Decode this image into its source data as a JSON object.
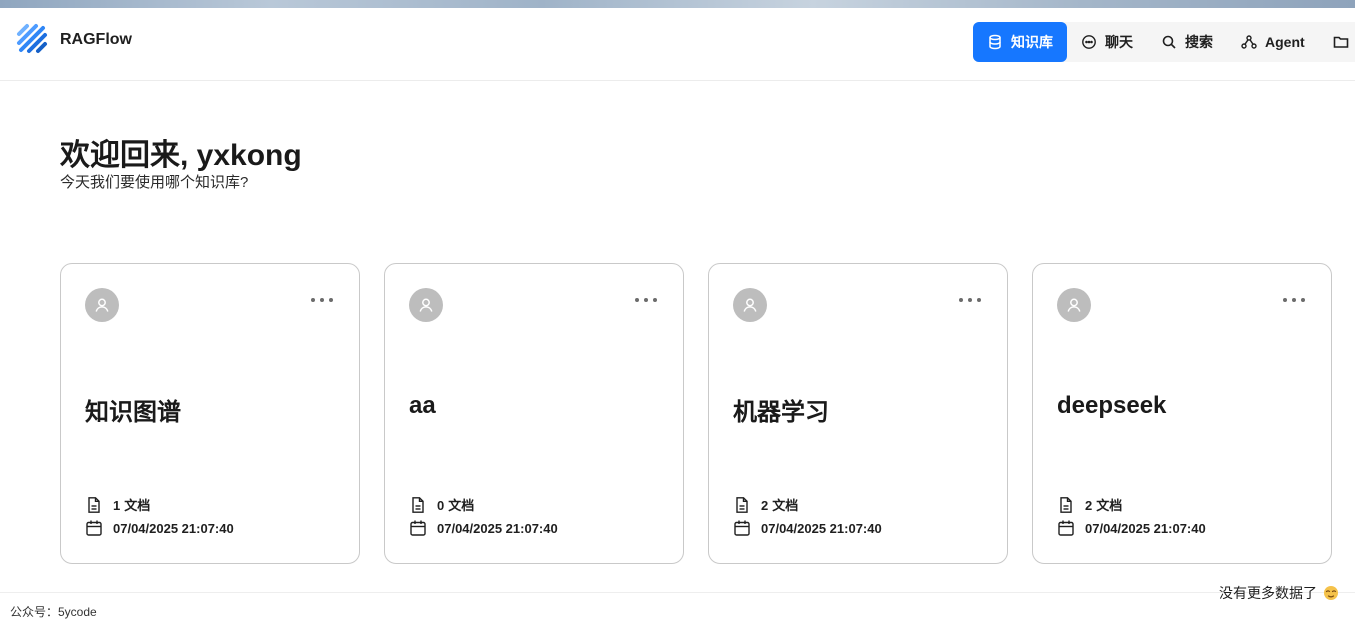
{
  "app": {
    "name": "RAGFlow"
  },
  "nav": {
    "items": [
      {
        "label": "知识库",
        "icon": "database-icon",
        "active": true
      },
      {
        "label": "聊天",
        "icon": "chat-icon",
        "active": false
      },
      {
        "label": "搜索",
        "icon": "search-icon",
        "active": false
      },
      {
        "label": "Agent",
        "icon": "agent-icon",
        "active": false
      },
      {
        "label": "",
        "icon": "folder-icon",
        "active": false
      }
    ]
  },
  "colors": {
    "accent": "#1677ff",
    "avatar_bg": "#bdbdbd"
  },
  "welcome": {
    "title": "欢迎回来, yxkong",
    "subtitle": "今天我们要使用哪个知识库?"
  },
  "cards": [
    {
      "title": "知识图谱",
      "doc_count": "1",
      "doc_label": "文档",
      "date": "07/04/2025 21:07:40"
    },
    {
      "title": "aa",
      "doc_count": "0",
      "doc_label": "文档",
      "date": "07/04/2025 21:07:40"
    },
    {
      "title": "机器学习",
      "doc_count": "2",
      "doc_label": "文档",
      "date": "07/04/2025 21:07:40"
    },
    {
      "title": "deepseek",
      "doc_count": "2",
      "doc_label": "文档",
      "date": "07/04/2025 21:07:40"
    }
  ],
  "footer": {
    "no_more": "没有更多数据了",
    "watermark": "公众号：5ycode"
  }
}
